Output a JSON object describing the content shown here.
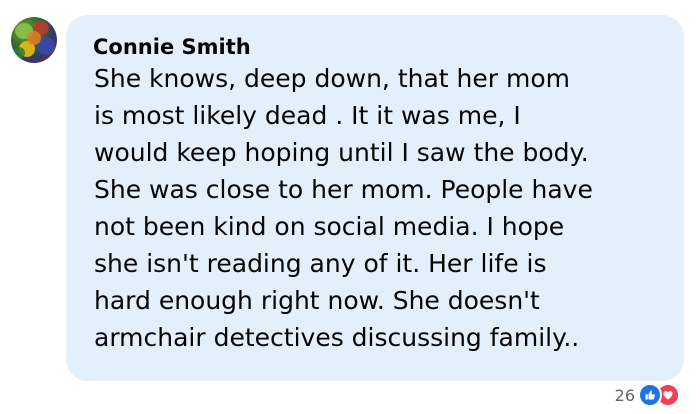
{
  "comment": {
    "author": "Connie Smith",
    "lines": [
      "She knows, deep down, that her mom",
      "is most likely dead . It it was me, I",
      "would keep hoping until I saw the body.",
      "She was close to her mom. People have",
      "not been kind on social media. I hope",
      "she isn't reading any of it. Her life is",
      "hard enough right now. She doesn't",
      "armchair detectives discussing family.."
    ]
  },
  "reactions": {
    "count": "26",
    "types": [
      "like-icon",
      "love-icon"
    ]
  },
  "colors": {
    "bubble": "#e4effc",
    "like": "#1b74e4",
    "love": "#f33e58",
    "text": "#050505",
    "muted": "#65676b"
  }
}
